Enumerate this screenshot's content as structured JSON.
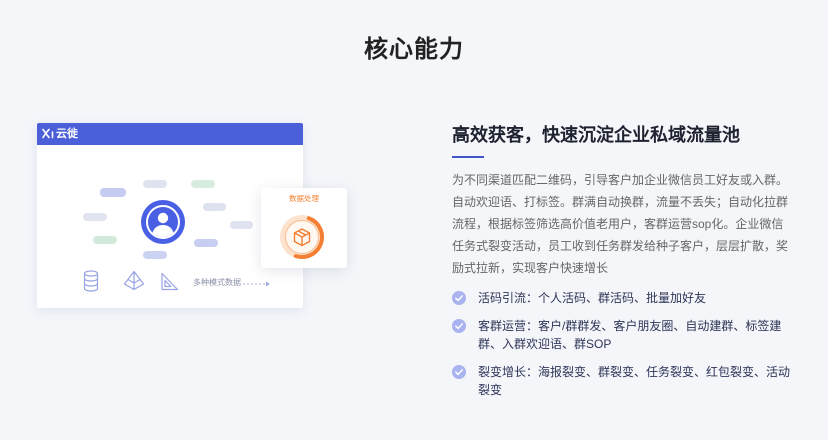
{
  "section": {
    "title": "核心能力"
  },
  "illustration": {
    "brand_name": "云徙",
    "brand_logo_icon": "yunxi-logo-icon",
    "center_icon": "user-avatar-icon",
    "bottom_icons": [
      "database-icon",
      "pyramid-icon",
      "triangle-ruler-icon"
    ],
    "caption": "多种模式数据",
    "caption_arrow_icon": "dashed-arrow-right-icon",
    "process_card": {
      "title": "数据处理",
      "icon": "package-box-icon"
    }
  },
  "feature": {
    "heading": "高效获客，快速沉淀企业私域流量池",
    "description": "为不同渠道匹配二维码，引导客户加企业微信员工好友或入群。自动欢迎语、打标签。群满自动换群，流量不丢失；自动化拉群流程，根据标签筛选高价值老用户，客群运营sop化。企业微信任务式裂变活动，员工收到任务群发给种子客户，层层扩散，奖励式拉新，实现客户快速增长",
    "list_icon": "check-circle-icon",
    "items": [
      {
        "text": "活码引流：个人活码、群活码、批量加好友"
      },
      {
        "text": "客群运营：客户/群群发、客户朋友圈、自动建群、标签建群、入群欢迎语、群SOP"
      },
      {
        "text": "裂变增长：海报裂变、群裂变、任务裂变、红包裂变、活动裂变"
      }
    ]
  },
  "colors": {
    "page_background": "#f4f6fa",
    "brand_blue": "#4b5fd9",
    "avatar_blue": "#4a60e4",
    "accent_line": "#3f55c9",
    "check_icon": "#a9b3ef",
    "icon_line": "#97a3e3",
    "process_orange": "#f47f33",
    "title_text": "#222222",
    "heading_text": "#1e2130",
    "body_text": "#666666",
    "list_text": "#2e3557",
    "caption_text": "#8a90a6"
  }
}
